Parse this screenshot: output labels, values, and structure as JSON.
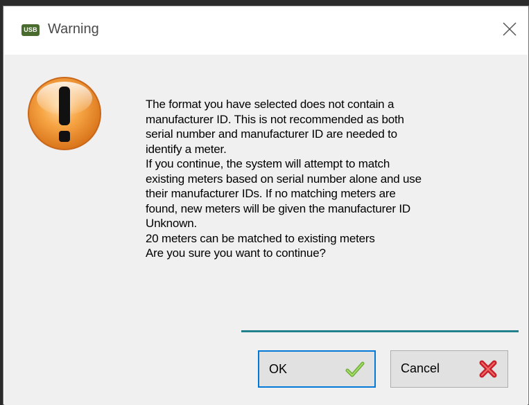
{
  "dialog": {
    "app_icon_text": "USB",
    "title": "Warning",
    "message_lines": [
      "The format you have selected does not contain a",
      "manufacturer ID. This is not recommended as both",
      "serial number and manufacturer ID are needed to",
      "identify a meter.",
      "If you continue, the system will attempt to match",
      "existing meters based on serial number alone and use",
      "their manufacturer IDs. If no matching meters are",
      "found, new meters will be given the manufacturer ID",
      "Unknown.",
      "20 meters can be matched to existing meters",
      "Are you sure you want to continue?"
    ],
    "icons": {
      "app": "usb-app-icon",
      "close": "close-icon",
      "warning": "warning-exclamation-icon",
      "ok": "checkmark-icon",
      "cancel": "red-x-icon"
    },
    "colors": {
      "accent_divider": "#20808c",
      "ok_focus_border": "#0078d7",
      "warning_orange": "#f39a2e"
    }
  },
  "buttons": {
    "ok_label": "OK",
    "cancel_label": "Cancel"
  }
}
